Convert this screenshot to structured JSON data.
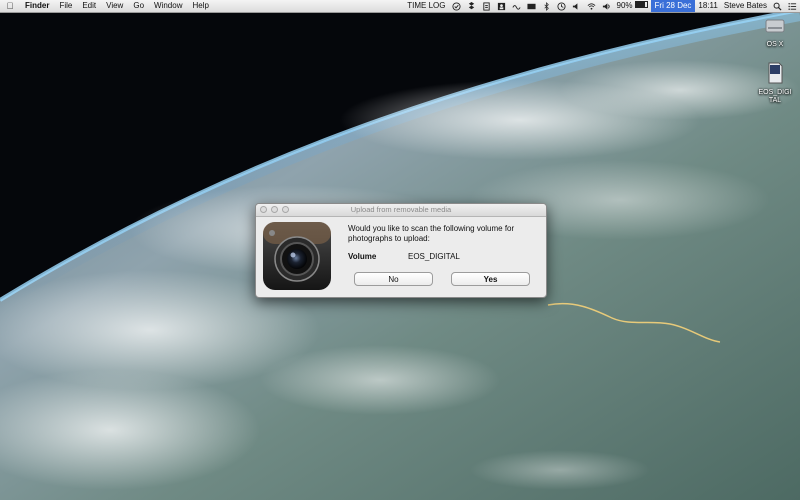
{
  "menubar": {
    "app_name": "Finder",
    "menus": [
      "File",
      "Edit",
      "View",
      "Go",
      "Window",
      "Help"
    ],
    "status_text": "TIME LOG",
    "battery": "90%",
    "date": "Fri 28 Dec",
    "time": "18:11",
    "user": "Steve Bates"
  },
  "desktop": {
    "icons": [
      {
        "label": "OS X",
        "icon": "hard-drive-icon"
      },
      {
        "label": "EOS_DIGITAL",
        "icon": "sd-card-icon"
      }
    ]
  },
  "dialog": {
    "title": "Upload from removable media",
    "message": "Would you like to scan the following volume for photographs to upload:",
    "volume_label": "Volume",
    "volume_value": "EOS_DIGITAL",
    "no_label": "No",
    "yes_label": "Yes",
    "app_icon": "camera-icon"
  }
}
